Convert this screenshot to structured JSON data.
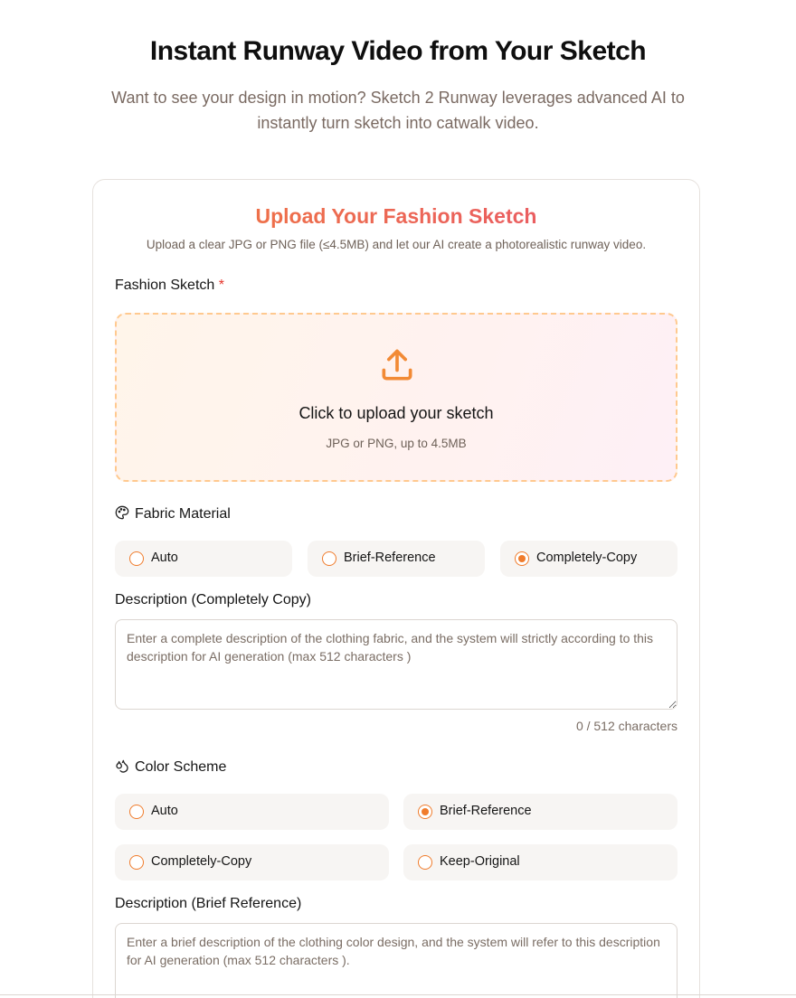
{
  "hero": {
    "title": "Instant Runway Video from Your Sketch",
    "subtitle": "Want to see your design in motion? Sketch 2 Runway leverages advanced AI to instantly turn sketch into catwalk video."
  },
  "card": {
    "title": "Upload Your Fashion Sketch",
    "subtitle": "Upload a clear JPG or PNG file (≤4.5MB) and let our AI create a photorealistic runway video."
  },
  "sketch": {
    "label": "Fashion Sketch",
    "required_mark": "*",
    "upload_title": "Click to upload your sketch",
    "upload_hint": "JPG or PNG, up to 4.5MB",
    "upload_icon": "upload-icon"
  },
  "fabric": {
    "label": "Fabric Material",
    "icon": "palette-icon",
    "options": [
      {
        "label": "Auto",
        "selected": false
      },
      {
        "label": "Brief-Reference",
        "selected": false
      },
      {
        "label": "Completely-Copy",
        "selected": true
      }
    ],
    "desc_label": "Description (Completely Copy)",
    "desc_placeholder": "Enter a complete description of the clothing fabric, and the system will strictly according to this description for AI generation (max 512 characters )",
    "desc_value": "",
    "counter": "0 / 512 characters"
  },
  "color": {
    "label": "Color Scheme",
    "icon": "droplets-icon",
    "options": [
      {
        "label": "Auto",
        "selected": false
      },
      {
        "label": "Brief-Reference",
        "selected": true
      },
      {
        "label": "Completely-Copy",
        "selected": false
      },
      {
        "label": "Keep-Original",
        "selected": false
      }
    ],
    "desc_label": "Description (Brief Reference)",
    "desc_placeholder": "Enter a brief description of the clothing color design, and the system will refer to this description for AI generation (max 512 characters ).",
    "desc_value": ""
  },
  "colors": {
    "accent": "#f07c2c",
    "title_gradient_start": "#f07a3c",
    "title_gradient_end": "#e8546e",
    "required": "#e5342b"
  }
}
